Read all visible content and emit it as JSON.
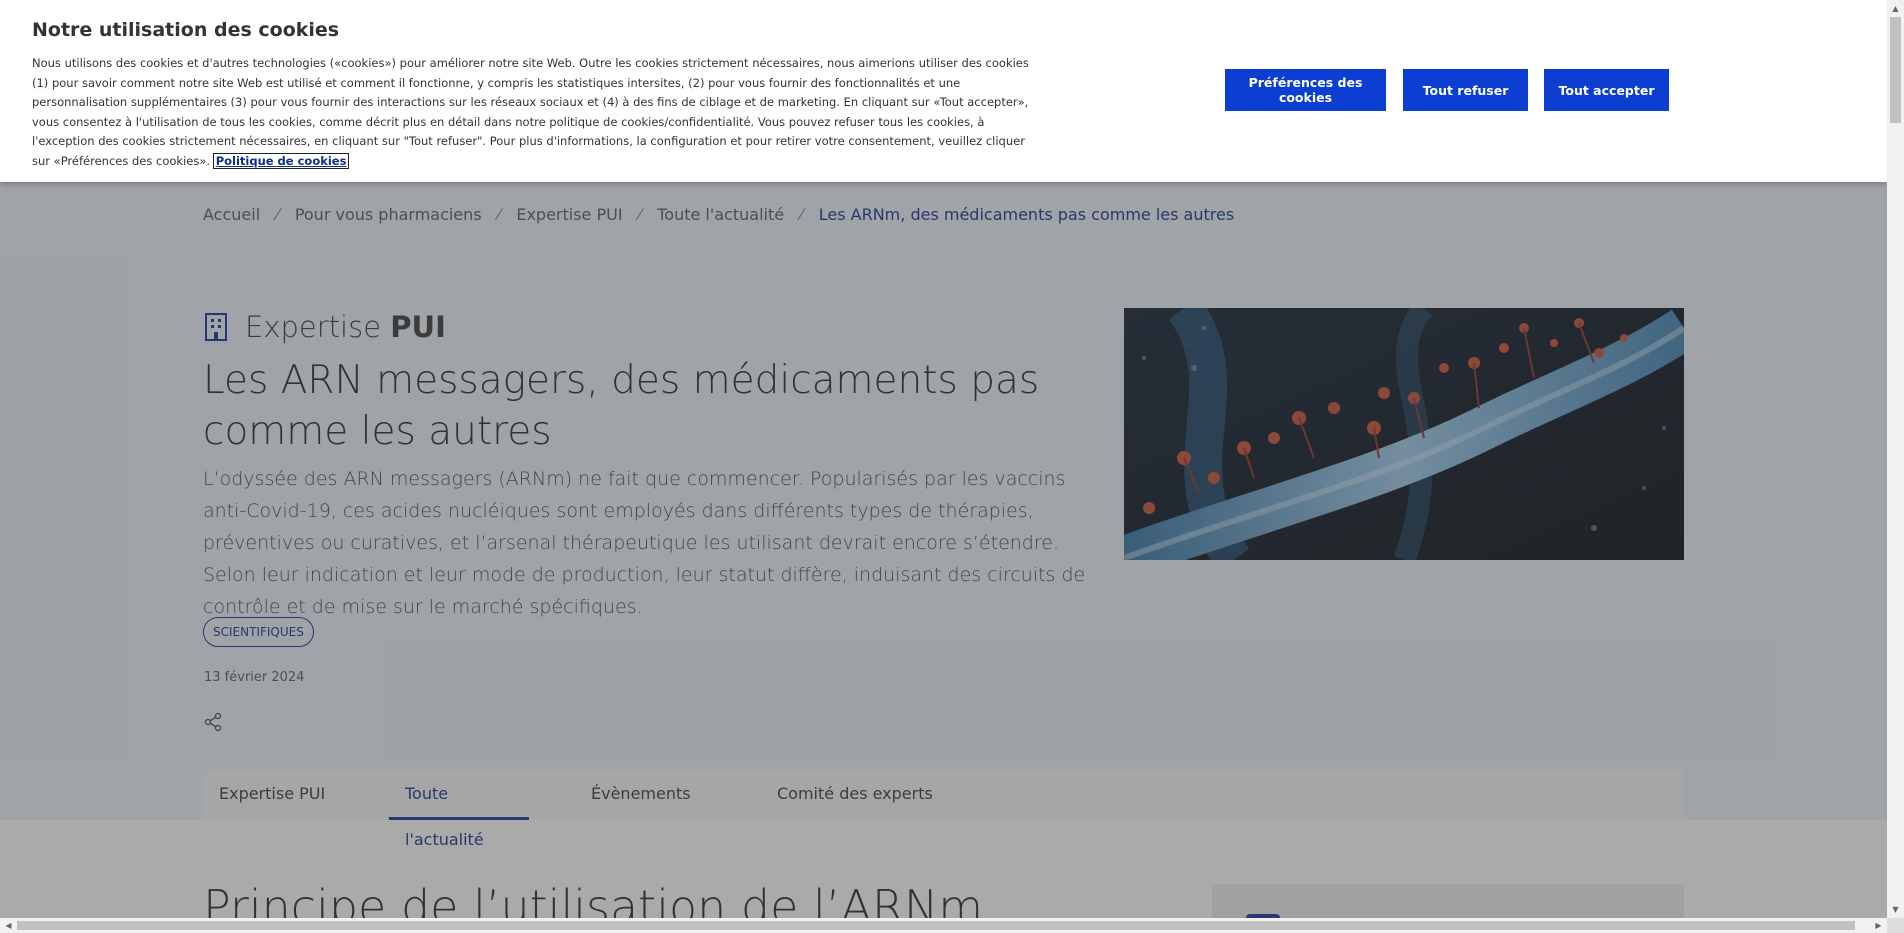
{
  "cookie_banner": {
    "title": "Notre utilisation des cookies",
    "text": "Nous utilisons des cookies et d'autres technologies («cookies») pour améliorer notre site Web. Outre les cookies strictement nécessaires, nous aimerions utiliser des cookies (1) pour savoir comment notre site Web est utilisé et comment il fonctionne, y compris les statistiques intersites, (2) pour vous fournir des fonctionnalités et une personnalisation supplémentaires (3) pour vous fournir des interactions sur les réseaux sociaux et (4) à des fins de ciblage et de marketing. En cliquant sur «Tout accepter», vous consentez à l'utilisation de tous les cookies, comme décrit plus en détail dans notre politique de cookies/confidentialité. Vous pouvez refuser tous les cookies, à l'exception des cookies strictement nécessaires, en cliquant sur \"Tout refuser\". Pour plus d'informations, la configuration et pour retirer votre consentement, veuillez cliquer sur «Préférences des cookies».",
    "policy_link": "Politique de cookies",
    "buttons": {
      "preferences": "Préférences des cookies",
      "reject_all": "Tout refuser",
      "accept_all": "Tout accepter"
    }
  },
  "breadcrumb": [
    "Accueil",
    "Pour vous pharmaciens",
    "Expertise PUI",
    "Toute l'actualité",
    "Les ARNm, des médicaments pas comme les autres"
  ],
  "section": {
    "label_light": "Expertise",
    "label_bold": "PUI",
    "icon": "building-icon"
  },
  "article": {
    "title": "Les ARN messagers, des médicaments pas comme les autres",
    "lede": "L’odyssée des ARN messagers (ARNm) ne fait que commencer. Popularisés par les vaccins anti-Covid-19, ces acides nucléiques sont employés dans différents types de thérapies, préventives ou curatives, et l’arsenal thérapeutique les utilisant devrait encore s’étendre. Selon leur indication et leur mode de production, leur statut diffère, induisant des circuits de contrôle et de mise sur le marché spécifiques.",
    "tag": "SCIENTIFIQUES",
    "date": "13 février 2024",
    "share_icon": "share-icon"
  },
  "tabs": [
    {
      "label": "Expertise PUI",
      "active": false
    },
    {
      "label": "Toute l'actualité",
      "active": true
    },
    {
      "label": "Évènements",
      "active": false
    },
    {
      "label": "Comité des experts",
      "active": false
    }
  ],
  "body": {
    "heading": "Principe de l’utilisation de l’ARNm"
  },
  "colors": {
    "brand": "#0b2f8a",
    "button": "#0b3ed1",
    "overlay": "rgba(70,70,70,0.45)"
  }
}
